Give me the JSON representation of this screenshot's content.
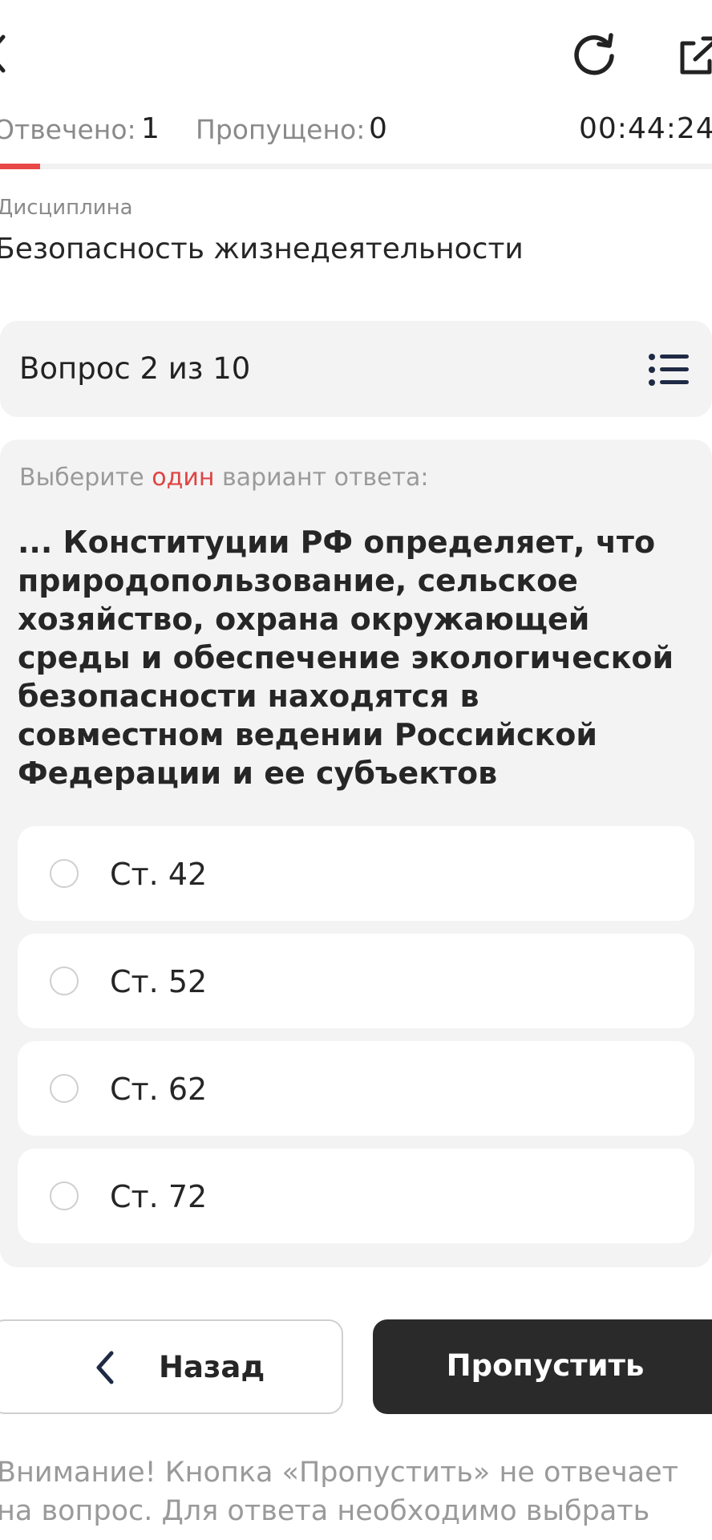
{
  "header": {
    "answered_label": "Отвечено:",
    "answered_value": "1",
    "skipped_label": "Пропущено:",
    "skipped_value": "0",
    "timer": "00:44:24",
    "progress_fraction": 0.1
  },
  "discipline": {
    "label": "Дисциплина",
    "value": "Безопасность жизнедеятельности"
  },
  "question": {
    "counter": "Вопрос 2 из 10",
    "instruction_prefix": "Выберите ",
    "instruction_highlight": "один",
    "instruction_suffix": " вариант ответа:",
    "text": "... Конституции РФ определяет, что природопользование, сельское хозяйство, охрана окружающей среды и обеспечение экологической безопасности находятся в совместном ведении Российской Федерации и ее субъектов",
    "options": [
      {
        "label": "Ст. 42"
      },
      {
        "label": "Ст. 52"
      },
      {
        "label": "Ст. 62"
      },
      {
        "label": "Ст. 72"
      }
    ]
  },
  "buttons": {
    "back": "Назад",
    "skip": "Пропустить"
  },
  "notice": "Внимание! Кнопка «Пропустить» не отвечает на вопрос. Для ответа необходимо выбрать",
  "colors": {
    "accent": "#e94848",
    "dark_button": "#2a2a2a",
    "card_bg": "#f3f3f3"
  },
  "icons": [
    "back-chevron-icon",
    "reload-icon",
    "share-icon",
    "list-icon",
    "chevron-left-icon"
  ]
}
